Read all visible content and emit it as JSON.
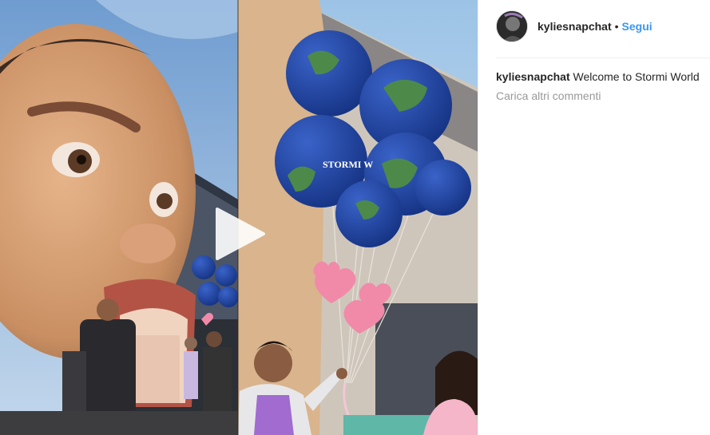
{
  "post": {
    "username": "kyliesnapchat",
    "separator": "•",
    "follow_label": "Segui",
    "caption_user": "kyliesnapchat",
    "caption_text": "Welcome to Stormi World",
    "load_more_label": "Carica altri commenti",
    "balloon_text": "STORMI W"
  },
  "icons": {
    "play": "play-icon",
    "avatar": "profile-avatar"
  },
  "colors": {
    "link": "#3897f0",
    "text": "#262626",
    "muted": "#999999",
    "sky": "#8fb7dd",
    "balloon_blue": "#1c3f9e",
    "balloon_green": "#4d8a4a",
    "heart_pink": "#f08aa8"
  }
}
